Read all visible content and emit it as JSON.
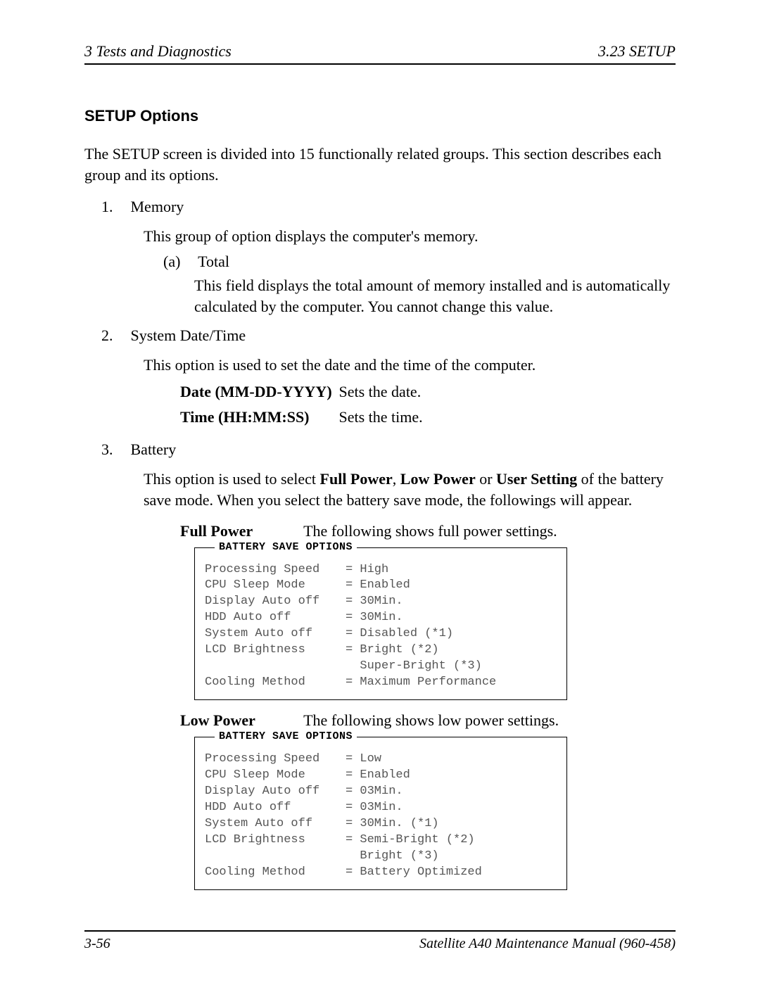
{
  "header": {
    "left": "3  Tests and Diagnostics",
    "right": "3.23  SETUP"
  },
  "section_title": "SETUP Options",
  "intro": "The SETUP screen is divided into 15 functionally related groups. This section describes each group and its options.",
  "item1": {
    "num": "1.",
    "title": "Memory",
    "desc": "This group of option displays the computer's memory.",
    "a_label": "(a)",
    "a_title": "Total",
    "a_body": "This field displays the total amount of memory installed and is automatically calculated by the computer. You cannot change this value."
  },
  "item2": {
    "num": "2.",
    "title": "System Date/Time",
    "desc": "This option is used to set the date and the time of the computer.",
    "date_term": "Date (MM-DD-YYYY)",
    "date_def": "Sets the date.",
    "time_term": "Time (HH:MM:SS)",
    "time_def": "Sets the time."
  },
  "item3": {
    "num": "3.",
    "title": "Battery",
    "desc_pre": "This option is used to select ",
    "b_full": "Full Power",
    "sep1": ", ",
    "b_low": "Low Power",
    "sep2": " or ",
    "b_user": "User Setting",
    "desc_post": " of the battery save mode. When you select the battery save mode, the followings will appear.",
    "full_title": "Full Power",
    "full_desc": "The following shows full power settings.",
    "low_title": "Low Power",
    "low_desc": "The following shows low power settings."
  },
  "box_title": "BATTERY SAVE OPTIONS",
  "full_opts": {
    "r0l": "Processing Speed",
    "r0v": "= High",
    "r1l": "CPU Sleep Mode",
    "r1v": "= Enabled",
    "r2l": "Display Auto off",
    "r2v": "= 30Min.",
    "r3l": "HDD Auto off",
    "r3v": "= 30Min.",
    "r4l": "System Auto off",
    "r4v": "= Disabled (*1)",
    "r5l": "LCD Brightness",
    "r5v": "= Bright (*2)",
    "r6l": "",
    "r6v": "  Super-Bright (*3)",
    "r7l": "Cooling Method",
    "r7v": "= Maximum Performance"
  },
  "low_opts": {
    "r0l": "Processing Speed",
    "r0v": "= Low",
    "r1l": "CPU Sleep Mode",
    "r1v": "= Enabled",
    "r2l": "Display Auto off",
    "r2v": "= 03Min.",
    "r3l": "HDD Auto off",
    "r3v": "= 03Min.",
    "r4l": "System Auto off",
    "r4v": "= 30Min. (*1)",
    "r5l": "LCD Brightness",
    "r5v": "= Semi-Bright (*2)",
    "r6l": "",
    "r6v": "  Bright (*3)",
    "r7l": "Cooling Method",
    "r7v": "= Battery Optimized"
  },
  "footer": {
    "left": "3-56",
    "right": "Satellite A40 Maintenance Manual (960-458)"
  }
}
